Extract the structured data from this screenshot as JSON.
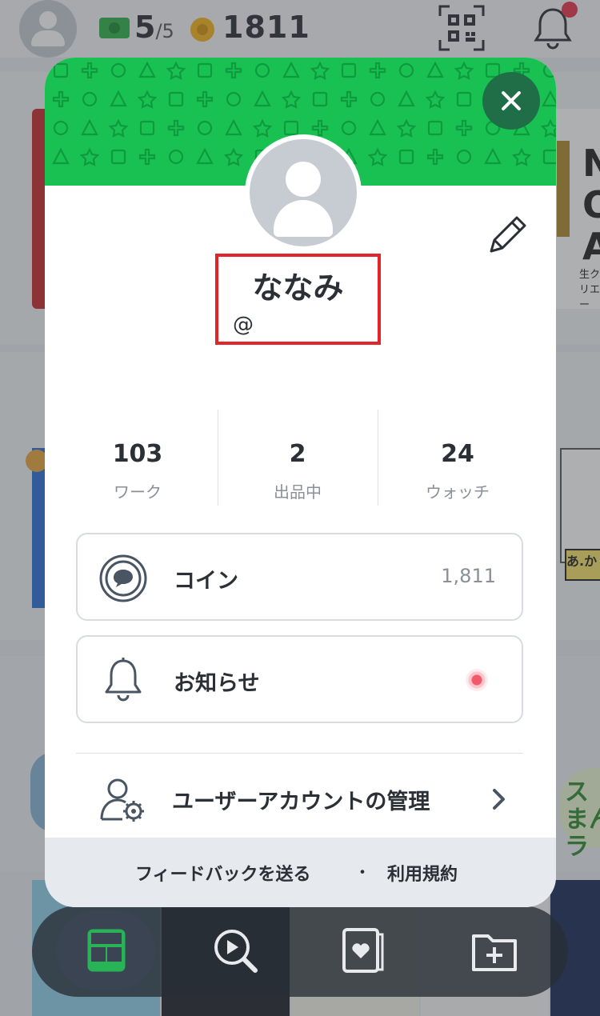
{
  "topbar": {
    "tickets_current": "5",
    "tickets_total": "/5",
    "coins": "1811"
  },
  "profile": {
    "name": "ななみ",
    "handle": "@"
  },
  "stats": [
    {
      "value": "103",
      "label": "ワーク"
    },
    {
      "value": "2",
      "label": "出品中"
    },
    {
      "value": "24",
      "label": "ウォッチ"
    }
  ],
  "rows": {
    "coin_label": "コイン",
    "coin_value": "1,811",
    "notice_label": "お知らせ",
    "account_label": "ユーザーアカウントの管理"
  },
  "footer": {
    "feedback": "フィードバックを送る",
    "separator": "・",
    "terms": "利用規約"
  },
  "background": {
    "card_right_text": "N\nO\nA",
    "card_right_sub": "生クリエー",
    "right_label": "あ.か",
    "right_manga": "ス\nまん\nラ"
  },
  "colors": {
    "header_green": "#19c153",
    "close_button": "#1f6e48",
    "highlight_red": "#e3242b",
    "notice_dot": "#f05a6a"
  },
  "icons": [
    "user-avatar-icon",
    "ticket-icon",
    "coin-icon",
    "qr-code-icon",
    "bell-icon",
    "close-icon",
    "pencil-icon",
    "coin-circle-icon",
    "account-settings-icon",
    "chevron-right-icon",
    "home-icon",
    "search-play-icon",
    "album-heart-icon",
    "folder-add-icon"
  ]
}
